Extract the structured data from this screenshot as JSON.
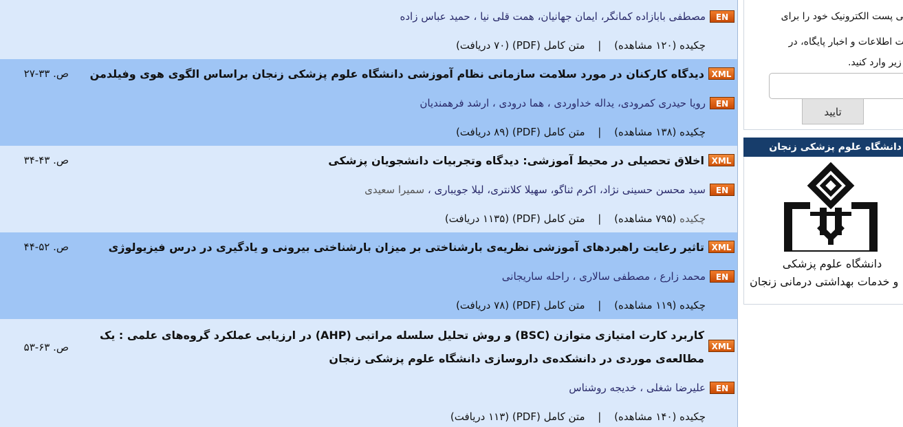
{
  "badges": {
    "en": "EN",
    "xml": "XML"
  },
  "articles": [
    {
      "title": "",
      "pages": "",
      "authors": "مصطفی بابازاده کمانگر، ایمان جهانیان، همت قلی نیا ، حمید عباس زاده",
      "abstract_label": "چکیده",
      "views": "(۱۲۰ مشاهده)",
      "fulltext": "متن کامل (PDF)",
      "downloads": "(۷۰ دریافت)"
    },
    {
      "title": "دیدگاه کارکنان در مورد سلامت سازمانی نظام آموزشی دانشگاه علوم پزشکی زنجان براساس الگوی هوی وفیلدمن",
      "pages": "ص. ۳۳-۲۷",
      "authors": "رویا حیدری کمرودی، یداله خداوردی ، هما درودی ، ارشد فرهمندیان",
      "abstract_label": "چکیده",
      "views": "(۱۳۸ مشاهده)",
      "fulltext": "متن کامل (PDF)",
      "downloads": "(۸۹ دریافت)"
    },
    {
      "title": "اخلاق تحصیلی در محیط آموزشی: دیدگاه وتجربیات دانشجویان پزشکی",
      "pages": "ص. ۴۳-۳۴",
      "authors": "سید محسن حسینی نژاد، اکرم ثناگو، سهیلا کلانتری، لیلا جویباری ،",
      "authors_grey": "سمیرا سعیدی",
      "abstract_label": "چکیده",
      "views": "(۷۹۵ مشاهده)",
      "fulltext": "متن کامل (PDF)",
      "downloads": "(۱۱۳۵ دریافت)"
    },
    {
      "title": "تاثیر رعایت راهبردهای آموزشی نظریه‌ی بارشناختی بر میزان بارشناختی بیرونی و یادگیری در درس فیزیولوژی",
      "pages": "ص. ۵۲-۴۴",
      "authors": "محمد زارع ، مصطفی سالاری ، راحله ساریجانی",
      "abstract_label": "چکیده",
      "views": "(۱۱۹ مشاهده)",
      "fulltext": "متن کامل (PDF)",
      "downloads": "(۷۸ دریافت)"
    },
    {
      "title_line1": "کاربرد کارت امتیازی متوازن (BSC) و روش تحلیل سلسله مراتبی (AHP) در ارزیابی عملکرد گروه‌های علمی : یک",
      "title_line2": "مطالعه‌ی موردی در دانشکده‌ی داروسازی دانشگاه علوم پزشکی زنجان",
      "pages": "ص. ۶۳-۵۳",
      "authors": "علیرضا شغلی ، خدیجه روشناس",
      "abstract_label": "چکیده",
      "views": "(۱۴۰ مشاهده)",
      "fulltext": "متن کامل (PDF)",
      "downloads": "(۱۱۳ دریافت)"
    }
  ],
  "separator": "|",
  "sidebar": {
    "newsletter_line1": "انی پست الکترونیک خود را برای",
    "newsletter_line2": "فت اطلاعات و اخبار پایگاه، در",
    "newsletter_line3": "ر زیر وارد کنید.",
    "email_value": "",
    "submit_label": "تایید",
    "uni_header": "دانشگاه علوم پزشکی زنجان",
    "uni_caption1": "دانشگاه علوم پزشکی",
    "uni_caption2": "و خدمات بهداشتی درمانی زنجان"
  },
  "colors": {
    "row_light": "#dbe9fb",
    "row_shade": "#9fc5f5",
    "header_bg": "#173d6b",
    "badge": "#e0620f"
  }
}
